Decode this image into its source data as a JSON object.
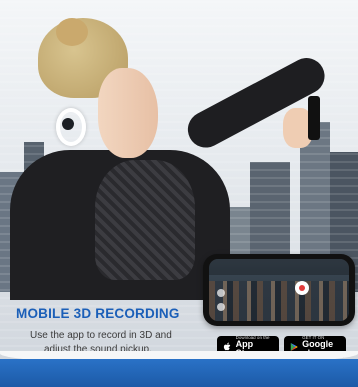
{
  "promo": {
    "headline": "MOBILE 3D RECORDING",
    "description_line1": "Use the app to record in 3D and",
    "description_line2": "adjust the sound pickup."
  },
  "store_buttons": {
    "appstore_small": "Download on the",
    "appstore_big": "App Store",
    "google_small": "GET IT ON",
    "google_big": "Google play"
  },
  "colors": {
    "headline": "#1b5fb8",
    "wave": "#2a72c7"
  },
  "icons": [
    "apple-icon",
    "google-play-icon",
    "record-button-icon"
  ]
}
